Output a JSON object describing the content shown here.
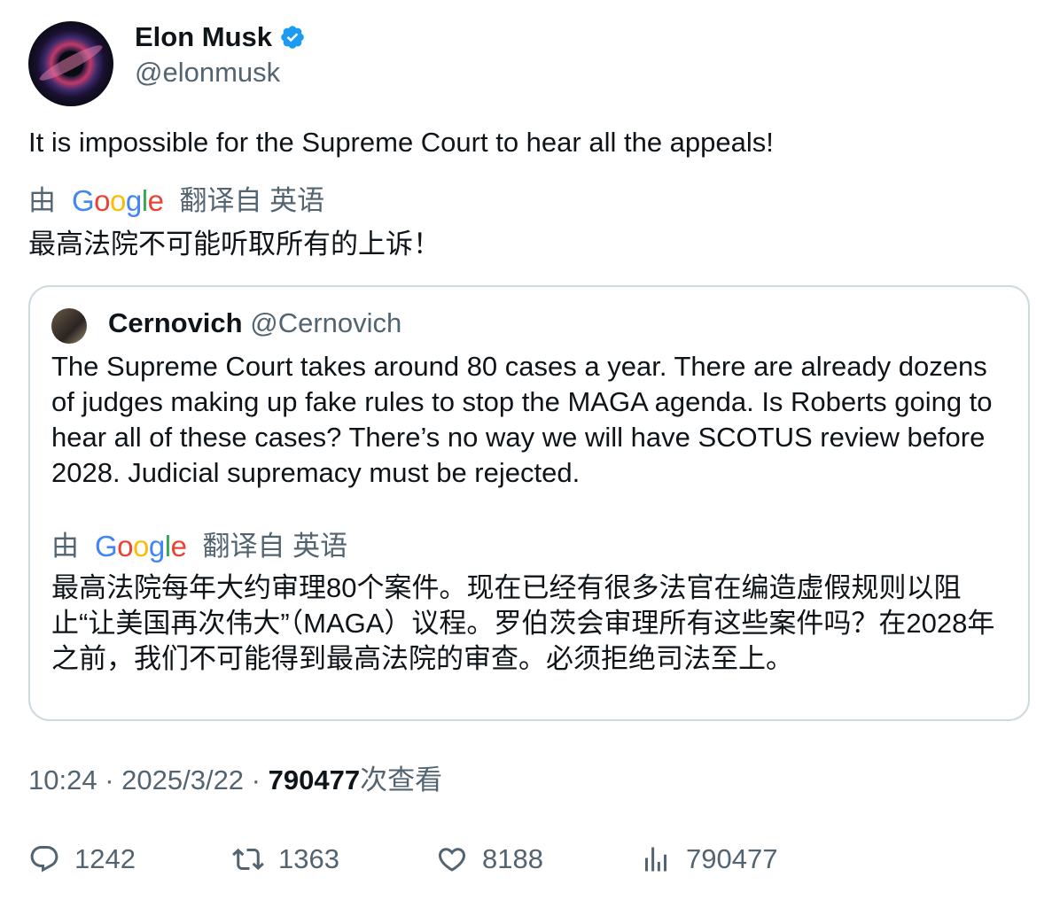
{
  "author": {
    "name": "Elon Musk",
    "handle": "@elonmusk",
    "verified": true
  },
  "tweet": {
    "text": "It is impossible for the Supreme Court to hear all the appeals!",
    "translation_prefix": "由",
    "translation_suffix": "翻译自 英语",
    "translated_text": "最高法院不可能听取所有的上诉！"
  },
  "quote": {
    "name": "Cernovich",
    "handle": "@Cernovich",
    "text": "The Supreme Court takes around 80 cases a year. There are already dozens of judges making up fake rules to stop the MAGA agenda. Is Roberts going to hear all of these cases? There’s no way we will have SCOTUS review before 2028. Judicial supremacy must be rejected.",
    "translation_prefix": "由",
    "translation_suffix": "翻译自 英语",
    "translated_text": "最高法院每年大约审理80个案件。现在已经有很多法官在编造虚假规则以阻止“让美国再次伟大”（MAGA）议程。罗伯茨会审理所有这些案件吗？在2028年之前，我们不可能得到最高法院的审查。必须拒绝司法至上。"
  },
  "meta": {
    "time": "10:24",
    "date": "2025/3/22",
    "views": "790477",
    "views_label": "次查看"
  },
  "actions": {
    "replies": "1242",
    "reposts": "1363",
    "likes": "8188",
    "views": "790477"
  },
  "colors": {
    "text": "#0f1419",
    "secondary": "#536471",
    "border": "#cfd9de",
    "verified": "#1d9bf0"
  }
}
